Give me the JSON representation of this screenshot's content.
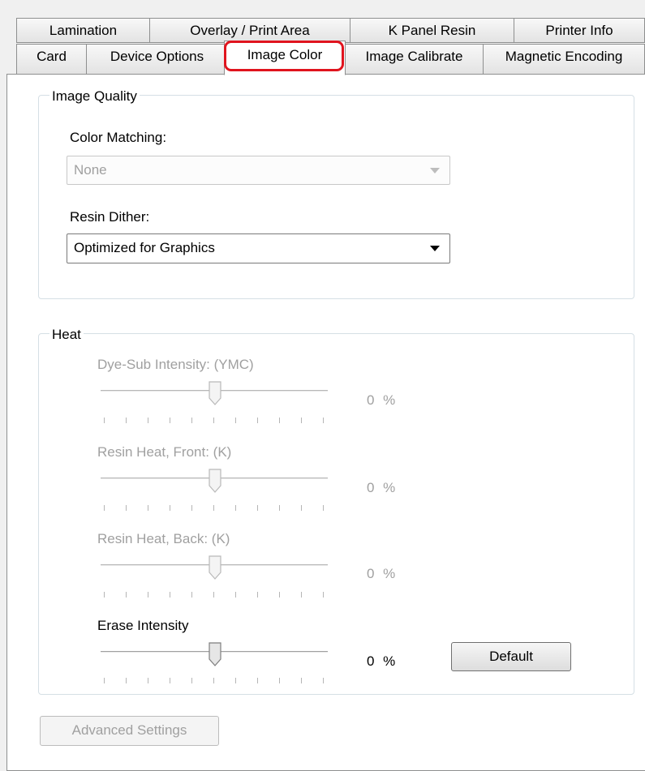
{
  "tabs_row1": [
    {
      "label": "Lamination"
    },
    {
      "label": "Overlay / Print Area"
    },
    {
      "label": "K Panel Resin"
    },
    {
      "label": "Printer Info"
    }
  ],
  "tabs_row2": [
    {
      "label": "Card"
    },
    {
      "label": "Device Options"
    },
    {
      "label": "Image Color",
      "selected": true
    },
    {
      "label": "Image Calibrate"
    },
    {
      "label": "Magnetic Encoding"
    }
  ],
  "highlight_color": "#e0141e",
  "image_quality": {
    "legend": "Image Quality",
    "color_matching_label": "Color Matching:",
    "color_matching_value": "None",
    "resin_dither_label": "Resin Dither:",
    "resin_dither_value": "Optimized for Graphics"
  },
  "heat": {
    "legend": "Heat",
    "sliders": [
      {
        "label": "Dye-Sub Intensity: (YMC)",
        "value_text": "0 %",
        "value": 0,
        "enabled": false
      },
      {
        "label": "Resin Heat, Front: (K)",
        "value_text": "0 %",
        "value": 0,
        "enabled": false
      },
      {
        "label": "Resin Heat, Back: (K)",
        "value_text": "0 %",
        "value": 0,
        "enabled": false
      },
      {
        "label": "Erase Intensity",
        "value_text": "0 %",
        "value": 0,
        "enabled": true
      }
    ],
    "default_button": "Default"
  },
  "advanced_button": "Advanced Settings"
}
